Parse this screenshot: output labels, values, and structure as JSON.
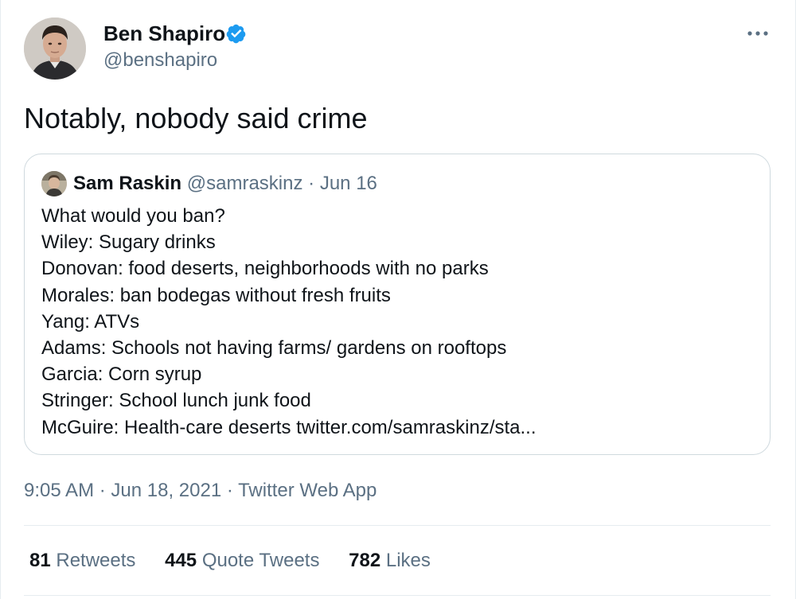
{
  "author": {
    "name": "Ben Shapiro",
    "handle": "@benshapiro",
    "verified": true
  },
  "tweet": {
    "text": "Notably, nobody said crime"
  },
  "quoted": {
    "name": "Sam Raskin",
    "handle": "@samraskinz",
    "separator": "·",
    "date": "Jun 16",
    "lines": [
      "What would you ban?",
      "Wiley: Sugary drinks",
      "Donovan: food deserts, neighborhoods with no parks",
      "Morales: ban bodegas without fresh fruits",
      "Yang: ATVs",
      "Adams: Schools not having farms/ gardens on rooftops",
      "Garcia: Corn syrup",
      "Stringer: School lunch junk food",
      "McGuire: Health-care deserts twitter.com/samraskinz/sta..."
    ]
  },
  "meta": {
    "timestamp": "9:05 AM · Jun 18, 2021 · Twitter Web App"
  },
  "stats": {
    "retweets_count": "81",
    "retweets_label": "Retweets",
    "quotes_count": "445",
    "quotes_label": "Quote Tweets",
    "likes_count": "782",
    "likes_label": "Likes"
  },
  "colors": {
    "primary_text": "#0f1419",
    "secondary_text": "#5b7083",
    "verified_blue": "#1d9bf0",
    "border": "#cfd9de"
  },
  "icons": {
    "verified": "verified-badge-icon",
    "more": "more-options-icon"
  }
}
